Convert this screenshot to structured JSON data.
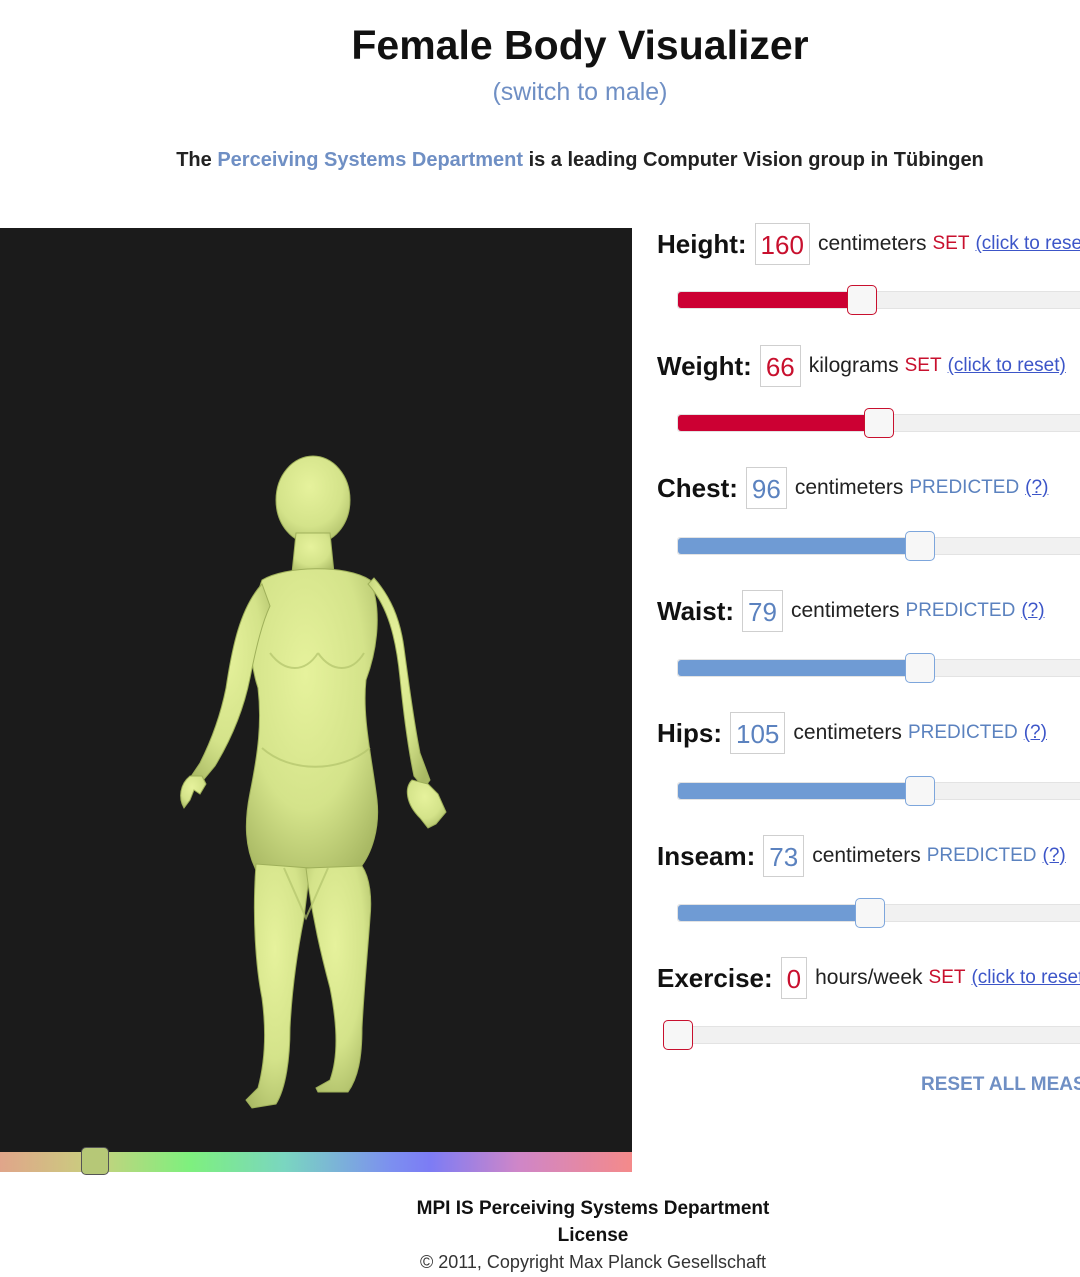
{
  "header": {
    "title": "Female Body Visualizer",
    "switch_link": "(switch to male)",
    "tagline_prefix": "The ",
    "tagline_link": "Perceiving Systems Department",
    "tagline_suffix": " is a leading Computer Vision group in Tübingen"
  },
  "viewer": {
    "background": "#1b1b1b",
    "body_color": "#d4e38a",
    "color_slider_position": 0.15
  },
  "controls": [
    {
      "id": "height",
      "label": "Height:",
      "value": "160",
      "unit": "centimeters",
      "status": "SET",
      "link": "(click to reset)",
      "state": "set",
      "level": 0.44
    },
    {
      "id": "weight",
      "label": "Weight:",
      "value": "66",
      "unit": "kilograms",
      "status": "SET",
      "link": "(click to reset)",
      "state": "set",
      "level": 0.48
    },
    {
      "id": "chest",
      "label": "Chest:",
      "value": "96",
      "unit": "centimeters",
      "status": "PREDICTED",
      "link": "(?)",
      "state": "pred",
      "level": 0.58
    },
    {
      "id": "waist",
      "label": "Waist:",
      "value": "79",
      "unit": "centimeters",
      "status": "PREDICTED",
      "link": "(?)",
      "state": "pred",
      "level": 0.58
    },
    {
      "id": "hips",
      "label": "Hips:",
      "value": "105",
      "unit": "centimeters",
      "status": "PREDICTED",
      "link": "(?)",
      "state": "pred",
      "level": 0.58
    },
    {
      "id": "inseam",
      "label": "Inseam:",
      "value": "73",
      "unit": "centimeters",
      "status": "PREDICTED",
      "link": "(?)",
      "state": "pred",
      "level": 0.46
    },
    {
      "id": "exercise",
      "label": "Exercise:",
      "value": "0",
      "unit": "hours/week",
      "status": "SET",
      "link": "(click to reset)",
      "state": "set",
      "level": 0.0
    }
  ],
  "reset_all": "RESET ALL MEASUREMENTS",
  "footer": {
    "dept": "MPI IS Perceiving Systems Department",
    "license": "License",
    "copyright": "© 2011, Copyright Max Planck Gesellschaft"
  },
  "colors": {
    "set_red": "#c8102e",
    "predicted_blue": "#5b82bf",
    "link_blue": "#6f8fc4"
  }
}
